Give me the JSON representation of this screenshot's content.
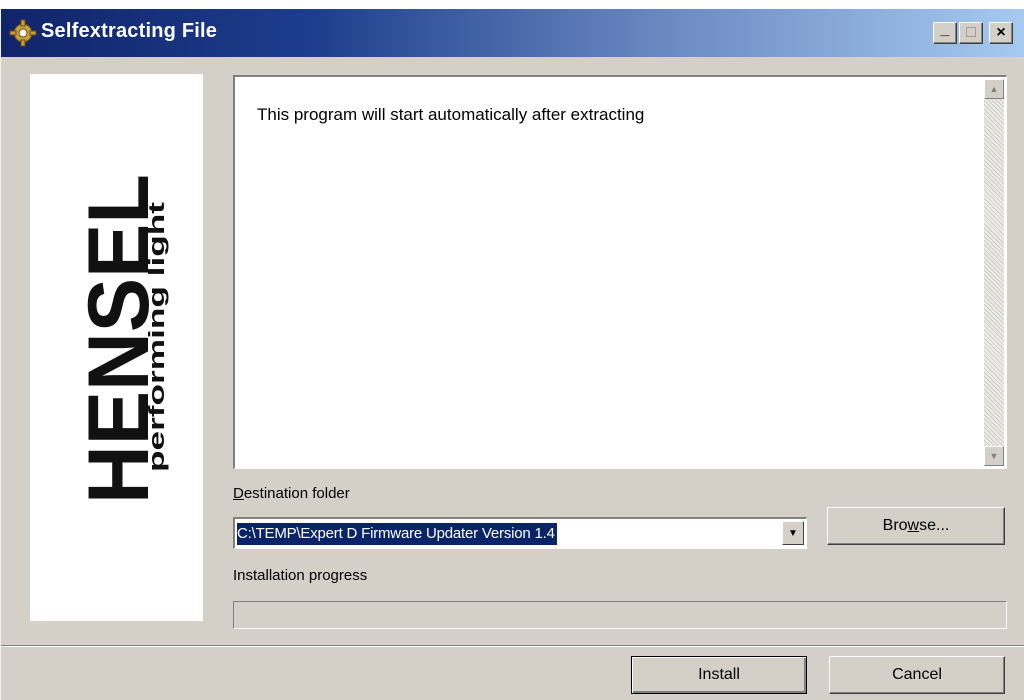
{
  "window": {
    "title": "Selfextracting File",
    "minimize_glyph": "_",
    "maximize_glyph": "□",
    "close_glyph": "×",
    "icon": "gear-icon"
  },
  "logo": {
    "brand": "HENSEL",
    "tagline": "performing light"
  },
  "message": {
    "text": "This program will start automatically after extracting"
  },
  "destination": {
    "label_prefix": "",
    "label_accel": "D",
    "label_rest": "estination folder",
    "value": "C:\\TEMP\\Expert D Firmware Updater Version 1.4"
  },
  "browse_button": {
    "pre": "Bro",
    "accel": "w",
    "post": "se..."
  },
  "progress": {
    "label": "Installation progress",
    "percent": 0
  },
  "actions": {
    "install": "Install",
    "cancel": "Cancel"
  },
  "colors": {
    "title_gradient_start": "#10246a",
    "title_gradient_end": "#a6caf0",
    "selection": "#0a246a",
    "face": "#d4d0c8"
  }
}
